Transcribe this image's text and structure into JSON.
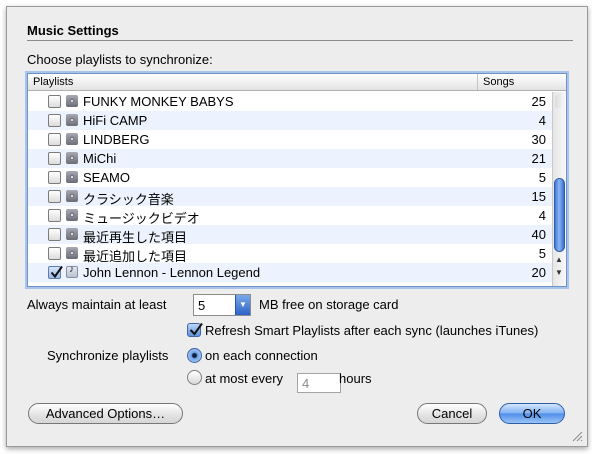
{
  "section_title": "Music Settings",
  "choose_label": "Choose playlists to synchronize:",
  "table": {
    "col_playlists": "Playlists",
    "col_songs": "Songs",
    "rows": [
      {
        "name": "FUNKY MONKEY BABYS",
        "songs": "25",
        "checked": false,
        "icon": "smart-playlist-icon"
      },
      {
        "name": "HiFi CAMP",
        "songs": "4",
        "checked": false,
        "icon": "smart-playlist-icon"
      },
      {
        "name": "LINDBERG",
        "songs": "30",
        "checked": false,
        "icon": "smart-playlist-icon"
      },
      {
        "name": "MiChi",
        "songs": "21",
        "checked": false,
        "icon": "smart-playlist-icon"
      },
      {
        "name": "SEAMO",
        "songs": "5",
        "checked": false,
        "icon": "smart-playlist-icon"
      },
      {
        "name": "クラシック音楽",
        "songs": "15",
        "checked": false,
        "icon": "smart-playlist-icon"
      },
      {
        "name": "ミュージックビデオ",
        "songs": "4",
        "checked": false,
        "icon": "smart-playlist-icon"
      },
      {
        "name": "最近再生した項目",
        "songs": "40",
        "checked": false,
        "icon": "smart-playlist-icon"
      },
      {
        "name": "最近追加した項目",
        "songs": "5",
        "checked": false,
        "icon": "smart-playlist-icon"
      },
      {
        "name": "John Lennon - Lennon Legend",
        "songs": "20",
        "checked": true,
        "icon": "music-playlist-icon"
      }
    ]
  },
  "maintain": {
    "label_before": "Always maintain at least",
    "value": "5",
    "label_after": "MB free on storage card"
  },
  "refresh_label": "Refresh Smart Playlists after each sync (launches iTunes)",
  "sync": {
    "label": "Synchronize playlists",
    "option_connection": "on each connection",
    "option_every": "at most every",
    "hours_placeholder": "4",
    "hours_label": "hours"
  },
  "buttons": {
    "advanced": "Advanced Options…",
    "cancel": "Cancel",
    "ok": "OK"
  },
  "colors": {
    "accent": "#4f8de9",
    "row_alt": "#edf3fe",
    "dialog_bg": "#ededed"
  }
}
